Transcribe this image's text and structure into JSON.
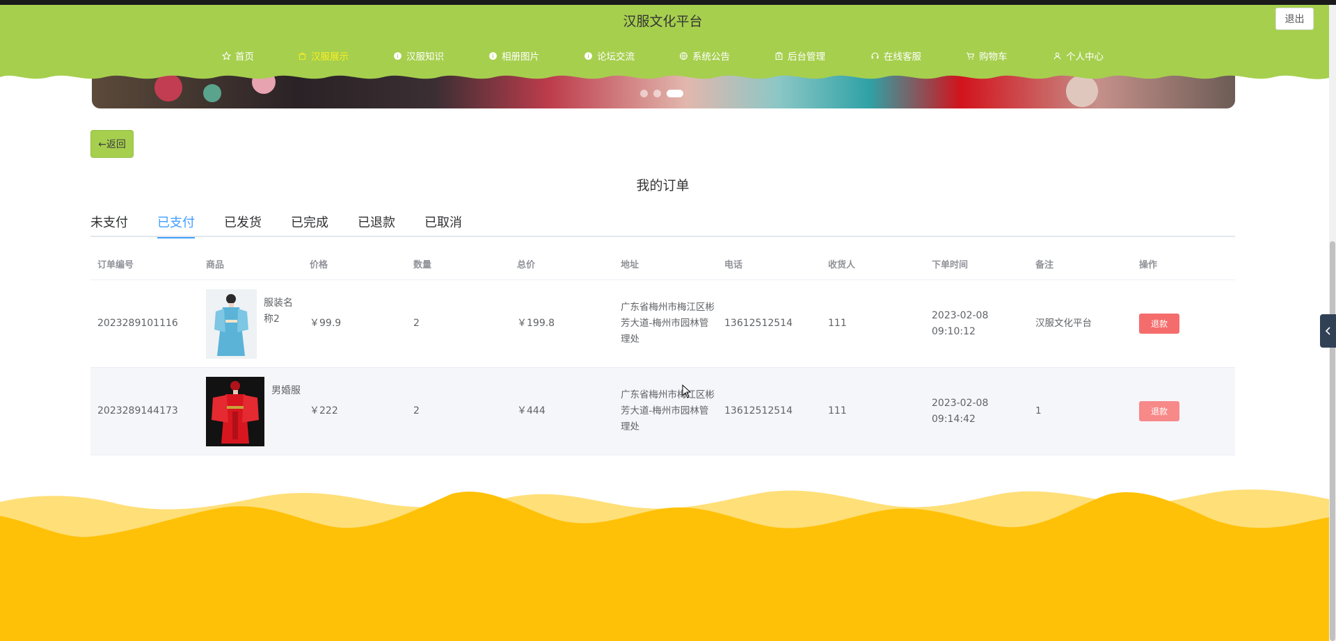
{
  "header": {
    "site_title": "汉服文化平台",
    "logout_label": "退出",
    "nav": [
      {
        "label": "首页",
        "icon": "star-icon"
      },
      {
        "label": "汉服展示",
        "icon": "bag-icon",
        "active": true
      },
      {
        "label": "汉服知识",
        "icon": "info-icon"
      },
      {
        "label": "相册图片",
        "icon": "info-icon"
      },
      {
        "label": "论坛交流",
        "icon": "info-icon"
      },
      {
        "label": "系统公告",
        "icon": "globe-icon"
      },
      {
        "label": "后台管理",
        "icon": "building-icon"
      },
      {
        "label": "在线客服",
        "icon": "headset-icon"
      },
      {
        "label": "购物车",
        "icon": "cart-icon"
      },
      {
        "label": "个人中心",
        "icon": "user-icon"
      }
    ]
  },
  "carousel": {
    "slide_count": 3,
    "active_index": 2
  },
  "back_label": "←返回",
  "page_title": "我的订单",
  "tabs": [
    {
      "label": "未支付"
    },
    {
      "label": "已支付",
      "active": true
    },
    {
      "label": "已发货"
    },
    {
      "label": "已完成"
    },
    {
      "label": "已退款"
    },
    {
      "label": "已取消"
    }
  ],
  "table": {
    "columns": [
      "订单编号",
      "商品",
      "价格",
      "数量",
      "总价",
      "地址",
      "电话",
      "收货人",
      "下单时间",
      "备注",
      "操作"
    ],
    "rows": [
      {
        "order_no": "2023289101116",
        "goods_name": "服装名称2",
        "price": "￥99.9",
        "quantity": "2",
        "total": "￥199.8",
        "address": "广东省梅州市梅江区彬芳大道-梅州市园林管理处",
        "phone": "13612512514",
        "receiver": "111",
        "order_time": "2023-02-08 09:10:12",
        "remark": "汉服文化平台",
        "action": "退款"
      },
      {
        "order_no": "2023289144173",
        "goods_name": "男婚服",
        "price": "￥222",
        "quantity": "2",
        "total": "￥444",
        "address": "广东省梅州市梅江区彬芳大道-梅州市园林管理处",
        "phone": "13612512514",
        "receiver": "111",
        "order_time": "2023-02-08 09:14:42",
        "remark": "1",
        "action": "退款"
      }
    ]
  },
  "colors": {
    "header_green": "#a6cf4e",
    "nav_active": "#fcee21",
    "tab_active": "#409eff",
    "refund_red": "#f56c6c",
    "footer_yellow": "#ffc107"
  }
}
